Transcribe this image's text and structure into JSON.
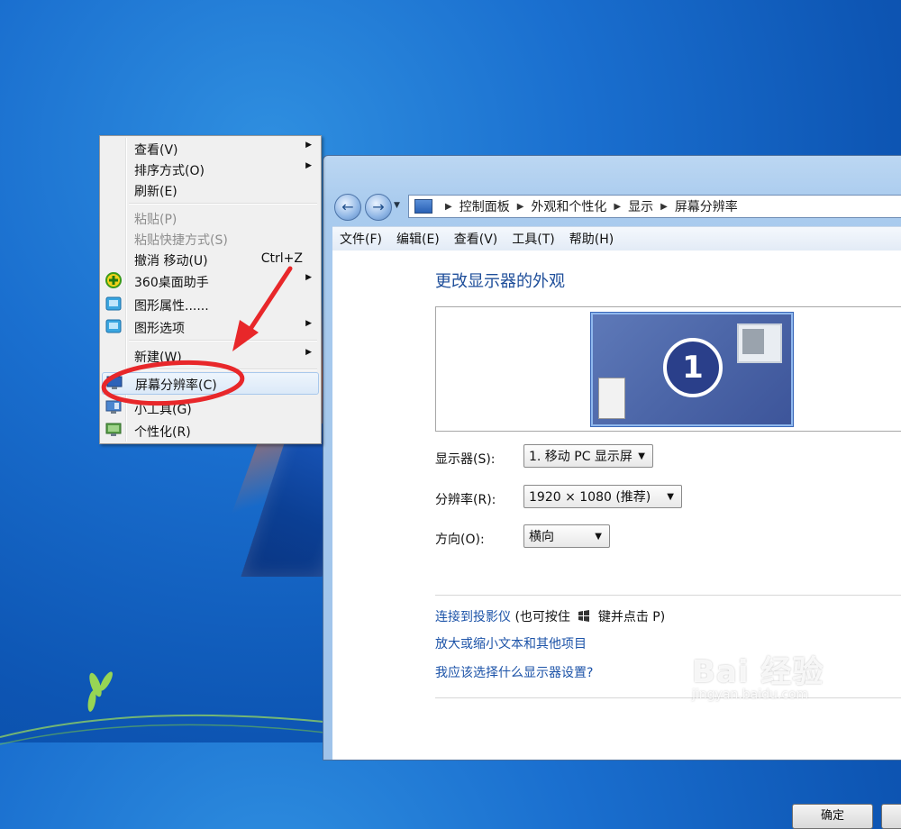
{
  "context_menu": {
    "items": [
      {
        "label": "查看(V)",
        "submenu": true
      },
      {
        "label": "排序方式(O)",
        "submenu": true
      },
      {
        "label": "刷新(E)"
      },
      {
        "label": "粘贴(P)",
        "disabled": true
      },
      {
        "label": "粘贴快捷方式(S)",
        "disabled": true
      },
      {
        "label": "撤消 移动(U)",
        "shortcut": "Ctrl+Z"
      },
      {
        "label": "360桌面助手",
        "submenu": true,
        "icon": "360-helper-icon"
      },
      {
        "label": "图形属性......",
        "icon": "graphics-properties-icon"
      },
      {
        "label": "图形选项",
        "submenu": true,
        "icon": "graphics-options-icon"
      },
      {
        "label": "新建(W)",
        "submenu": true
      },
      {
        "label": "屏幕分辨率(C)",
        "icon": "screen-resolution-icon",
        "highlighted": true
      },
      {
        "label": "小工具(G)",
        "icon": "gadgets-icon"
      },
      {
        "label": "个性化(R)",
        "icon": "personalize-icon"
      }
    ]
  },
  "window": {
    "breadcrumb": [
      "控制面板",
      "外观和个性化",
      "显示",
      "屏幕分辨率"
    ],
    "menubar": [
      "文件(F)",
      "编辑(E)",
      "查看(V)",
      "工具(T)",
      "帮助(H)"
    ],
    "page_title": "更改显示器的外观",
    "monitor_number": "1",
    "display_label": "显示器(S):",
    "display_value": "1. 移动 PC 显示屏",
    "resolution_label": "分辨率(R):",
    "resolution_value": "1920 × 1080 (推荐)",
    "orientation_label": "方向(O):",
    "orientation_value": "横向",
    "link_projector": "连接到投影仪",
    "link_projector_note_a": "(也可按住",
    "link_projector_note_b": "键并点击 P)",
    "link_text_size": "放大或缩小文本和其他项目",
    "link_which_settings": "我应该选择什么显示器设置?",
    "ok_label": "确定"
  },
  "watermark": {
    "main": "Bai 经验",
    "sub": "jingyan.baidu.com"
  },
  "colors": {
    "annotation_red": "#e8272a",
    "link_blue": "#1c53a8",
    "title_blue": "#1e4e9a"
  }
}
